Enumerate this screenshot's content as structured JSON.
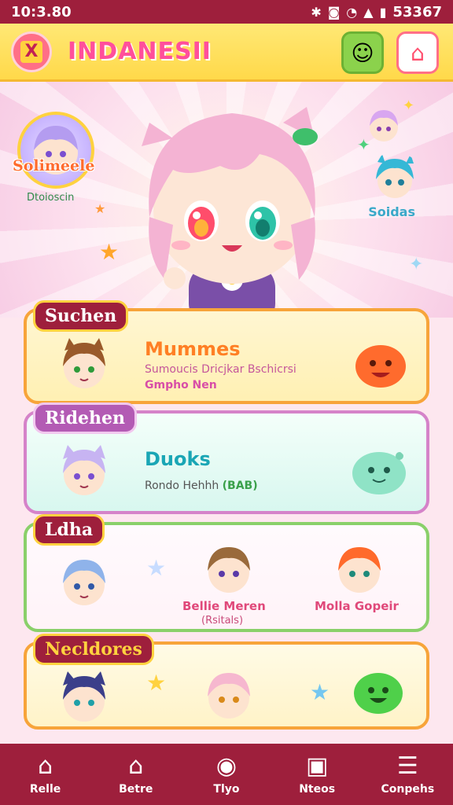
{
  "status": {
    "time": "10:3.80",
    "right": "53367"
  },
  "header": {
    "title": "INDANESII",
    "close_label": "X"
  },
  "hero": {
    "badge_title": "Solimeele",
    "badge_sub": "Dtoioscin",
    "side_label": "Soidas"
  },
  "cards": [
    {
      "label": "Suchen",
      "title": "Mummes",
      "sub": "Sumoucis Dricjkar Bschicrsi",
      "sub2": "Gmpho Nen",
      "title_color": "#ff7f24",
      "sub_color": "#d84ea7"
    },
    {
      "label": "Ridehen",
      "title": "Duoks",
      "sub": "Rondo Hehhh",
      "sub_tag": "(BAB)",
      "title_color": "#1aa6b5"
    },
    {
      "label": "Ldha",
      "name1": "Bellie Meren",
      "name1_sub": "(Rsitals)",
      "name2": "Molla Gopeir"
    },
    {
      "label": "Necldores"
    }
  ],
  "nav": [
    {
      "label": "Relle",
      "icon": "home-icon"
    },
    {
      "label": "Betre",
      "icon": "house-outline-icon"
    },
    {
      "label": "Tlyo",
      "icon": "play-circle-icon"
    },
    {
      "label": "Nteos",
      "icon": "inbox-icon"
    },
    {
      "label": "Conpehs",
      "icon": "menu-icon"
    }
  ],
  "colors": {
    "status": "#9e1f3c",
    "header": "#ffd94a",
    "title": "#ff4f9b"
  }
}
